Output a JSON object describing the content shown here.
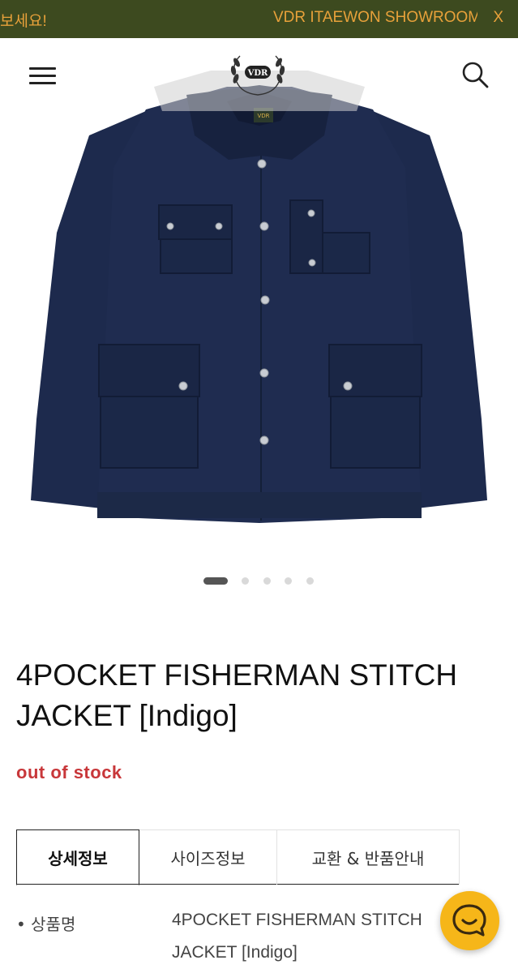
{
  "topbar": {
    "ticker_left": "보세요!",
    "ticker_right": "VDR ITAEWON SHOWROOM",
    "close_label": "X"
  },
  "header": {
    "menu_icon": "hamburger-menu-icon",
    "logo_text": "VDR",
    "search_icon": "search-icon"
  },
  "product": {
    "title": "4POCKET FISHERMAN STITCH JACKET [Indigo]",
    "stock_status": "out of stock",
    "image": {
      "icon": "jacket-product-image",
      "label_text": "VDR"
    }
  },
  "carousel": {
    "count": 5,
    "active": 0
  },
  "tabs": [
    {
      "label": "상세정보",
      "active": true
    },
    {
      "label": "사이즈정보",
      "active": false
    },
    {
      "label": "교환 & 반품안내",
      "active": false
    }
  ],
  "info": {
    "name_label": "• 상품명",
    "name_value": "4POCKET FISHERMAN STITCH JACKET [Indigo]"
  },
  "chat": {
    "icon": "chat-bubble-icon"
  },
  "colors": {
    "topbar_bg": "#3d4a1f",
    "topbar_text": "#e8a13a",
    "stock": "#c8373a",
    "chat_bg": "#f6b619",
    "jacket": "#1d2a4d"
  }
}
